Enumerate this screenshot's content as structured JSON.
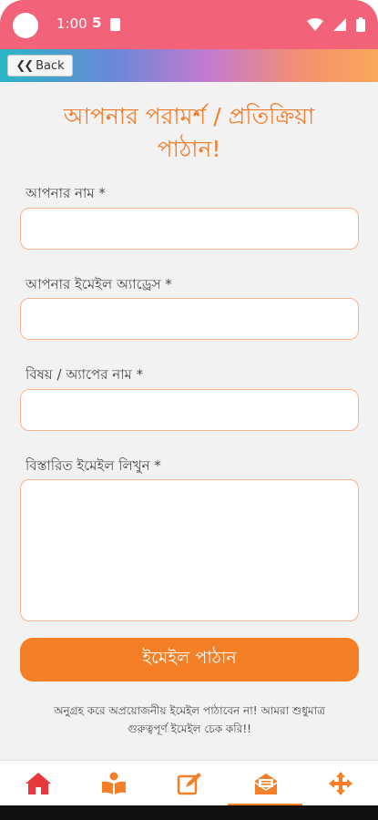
{
  "status": {
    "time": "1:00",
    "s_icon": "5"
  },
  "nav": {
    "back_label": "Back"
  },
  "form": {
    "title_line1": "আপনার পরামর্শ / প্রতিক্রিয়া",
    "title_line2": "পাঠান!",
    "name_label": "আপনার নাম *",
    "email_label": "আপনার ইমেইল অ্যাড্রেস *",
    "subject_label": "বিষয় / অ্যাপের নাম *",
    "message_label": "বিস্তারিত ইমেইল লিখুন *",
    "name_value": "",
    "email_value": "",
    "subject_value": "",
    "message_value": "",
    "send_label": "ইমেইল পাঠান",
    "note_line1": "অনুগ্রহ করে অপ্রয়োজনীয় ইমেইল পাঠাবেন না! আমরা শুধুমাত্র",
    "note_line2": "গুরুত্বপূর্ণ ইমেইল চেক করি!!"
  },
  "tabs": [
    {
      "icon": "home-icon",
      "active": false
    },
    {
      "icon": "book-reader-icon",
      "active": false
    },
    {
      "icon": "edit-icon",
      "active": false
    },
    {
      "icon": "envelope-open-icon",
      "active": true
    },
    {
      "icon": "move-arrows-icon",
      "active": false
    }
  ],
  "colors": {
    "accent": "#f57f26",
    "status_bar": "#f2637a",
    "tab_icon": "#f57f26"
  }
}
